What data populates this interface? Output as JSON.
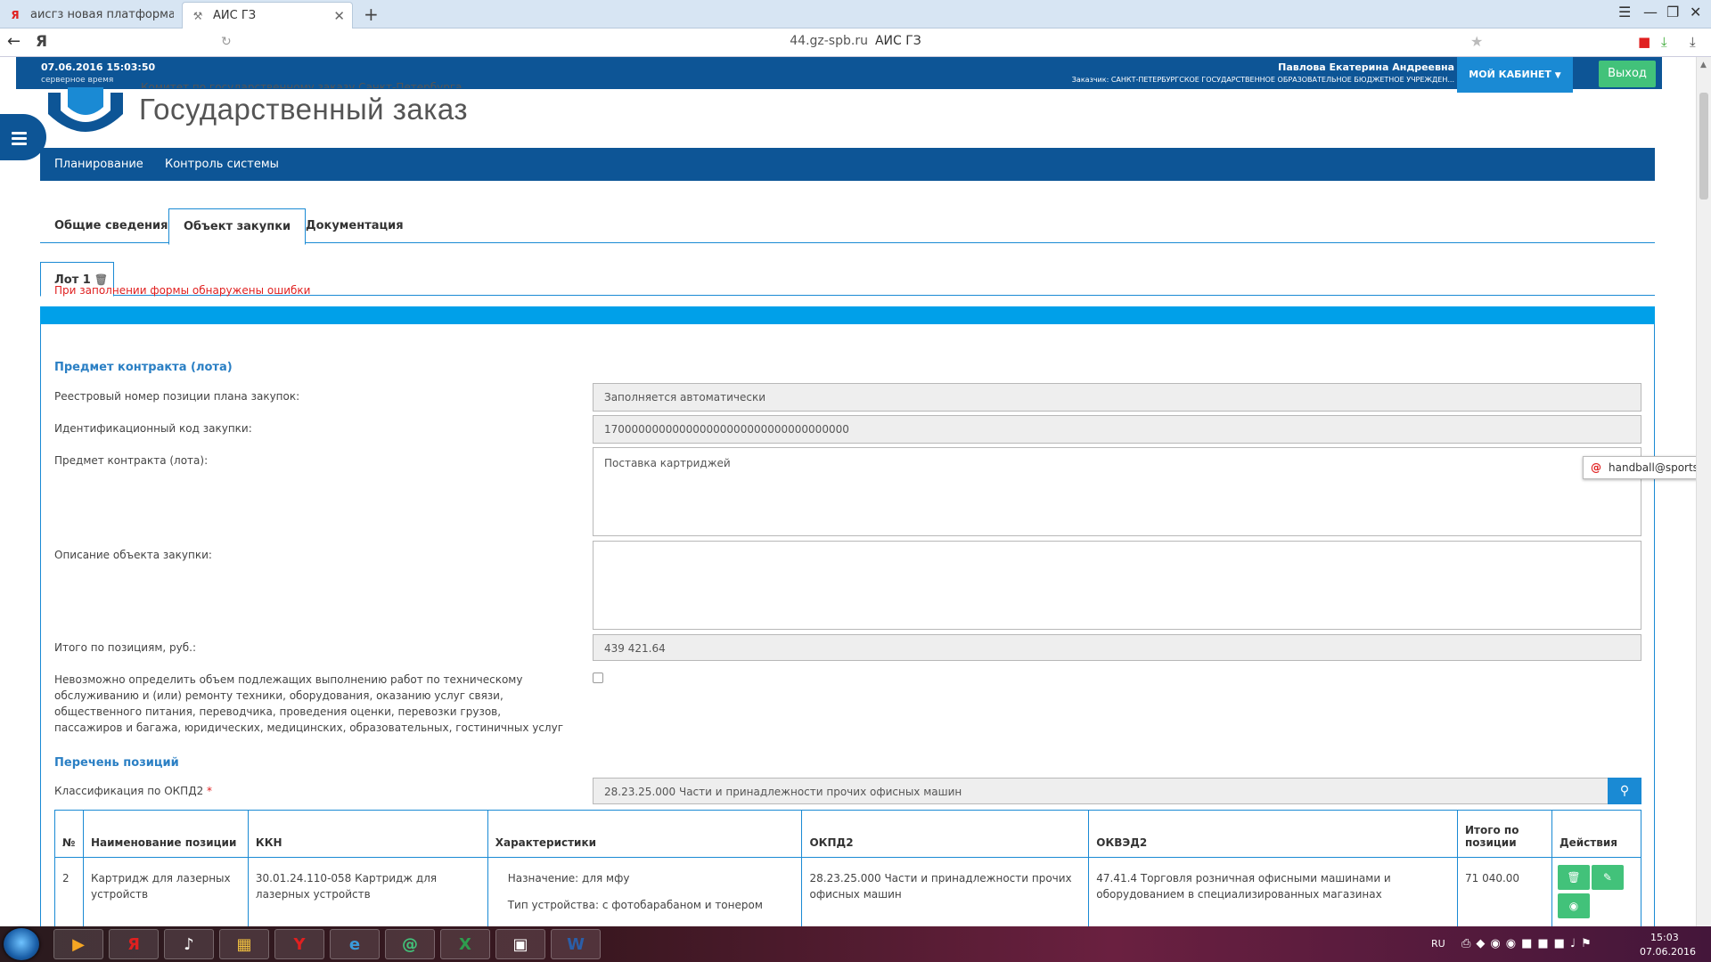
{
  "browser": {
    "tabs": [
      {
        "label": "аисгз новая платформа — Яндекс"
      },
      {
        "label": "АИС ГЗ"
      }
    ],
    "url_domain": "44.gz-spb.ru",
    "url_title": "АИС ГЗ",
    "search_letter": "Я"
  },
  "header": {
    "datetime": "07.06.2016 15:03:50",
    "server_time_label": "серверное время",
    "user_name": "Павлова Екатерина Андреевна",
    "customer": "Заказчик: САНКТ-ПЕТЕРБУРГСКОЕ ГОСУДАРСТВЕННОЕ ОБРАЗОВАТЕЛЬНОЕ БЮДЖЕТНОЕ УЧРЕЖДЕН...",
    "cabinet_label": "МОЙ КАБИНЕТ",
    "exit_label": "Выход",
    "brand_subtitle": "Комитет по государственному заказу Санкт-Петербурга",
    "brand_title": "Государственный заказ"
  },
  "nav": {
    "items": [
      "Планирование",
      "Контроль системы"
    ]
  },
  "tabs": [
    "Общие сведения",
    "Объект закупки",
    "Документация"
  ],
  "lot_tab": "Лот 1",
  "form": {
    "error_message": "При заполнении формы обнаружены ошибки",
    "section_subject": "Предмет контракта (лота)",
    "registry_label": "Реестровый номер позиции плана закупок:",
    "registry_value": "Заполняется автоматически",
    "idcode_label": "Идентификационный код закупки:",
    "idcode_value": "170000000000000000000000000000000000",
    "subject_label": "Предмет контракта (лота):",
    "subject_value": "Поставка картриджей",
    "description_label": "Описание объекта закупки:",
    "description_value": "",
    "total_label": "Итого по позициям, руб.:",
    "total_value": "439 421.64",
    "impossible_label": "Невозможно определить объем подлежащих выполнению работ по техническому обслуживанию и (или) ремонту техники, оборудования, оказанию услуг связи, общественного питания, переводчика, проведения оценки, перевозки грузов, пассажиров и багажа, юридических, медицинских, образовательных, гостиничных услуг",
    "section_positions": "Перечень позиций",
    "okpd_label": "Классификация по ОКПД2",
    "okpd_value": "28.23.25.000 Части и принадлежности прочих офисных машин"
  },
  "tooltip": "handball@sportschool",
  "table": {
    "headers": [
      "№",
      "Наименование позиции",
      "ККН",
      "Характеристики",
      "ОКПД2",
      "ОКВЭД2",
      "Итого по позиции",
      "Действия"
    ],
    "rows": [
      {
        "num": "2",
        "name": "Картридж для лазерных устройств",
        "kkn": "30.01.24.110-058 Картридж для лазерных устройств",
        "char1": "Назначение: для мфу",
        "char2": "Тип устройства: с фотобарабаном и тонером",
        "okpd2": "28.23.25.000 Части и принадлежности прочих офисных машин",
        "okved2": "47.41.4 Торговля розничная офисными машинами и оборудованием в специализированных магазинах",
        "total": "71 040.00"
      }
    ]
  },
  "taskbar": {
    "lang": "RU",
    "time": "15:03",
    "date": "07.06.2016"
  },
  "colors": {
    "primary": "#0d5596",
    "accent": "#1a8ad4",
    "light_accent": "#00a0e9",
    "success": "#42c27a",
    "error": "#e02020"
  }
}
